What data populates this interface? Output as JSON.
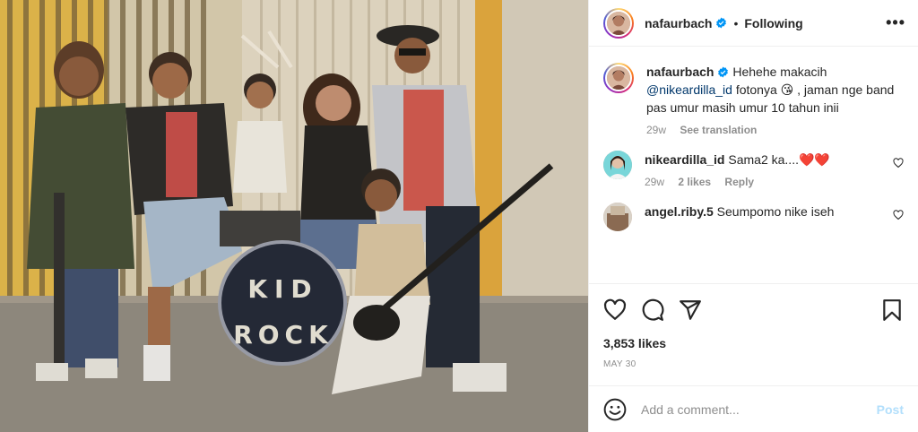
{
  "header": {
    "username": "nafaurbach",
    "dot": "•",
    "follow_status": "Following",
    "more_label": "•••"
  },
  "photo": {
    "drum_text_line1": "KID",
    "drum_text_line2": "ROCK"
  },
  "caption": {
    "username": "nafaurbach",
    "text_before": "Hehehe makacih",
    "mention": "@nikeardilla_id",
    "text_after": "fotonya 😘 , jaman nge band pas umur masih umur 10 tahun inii",
    "time": "29w",
    "see_translation": "See translation"
  },
  "comments": [
    {
      "username": "nikeardilla_id",
      "text": "Sama2 ka....❤️❤️",
      "time": "29w",
      "likes": "2 likes",
      "reply": "Reply"
    },
    {
      "username": "angel.riby.5",
      "text": "Seumpomo nike iseh"
    }
  ],
  "stats": {
    "likes": "3,853 likes",
    "date": "MAY 30"
  },
  "add_comment": {
    "placeholder": "Add a comment...",
    "post_label": "Post"
  },
  "colors": {
    "link": "#00376b",
    "muted": "#8e8e8e",
    "verified": "#0095f6",
    "post_disabled": "#b2dffc",
    "heart_red": "#ed4956"
  },
  "icons": [
    "heart-icon",
    "comment-icon",
    "share-icon",
    "bookmark-icon",
    "emoji-icon",
    "verified-badge-icon"
  ]
}
